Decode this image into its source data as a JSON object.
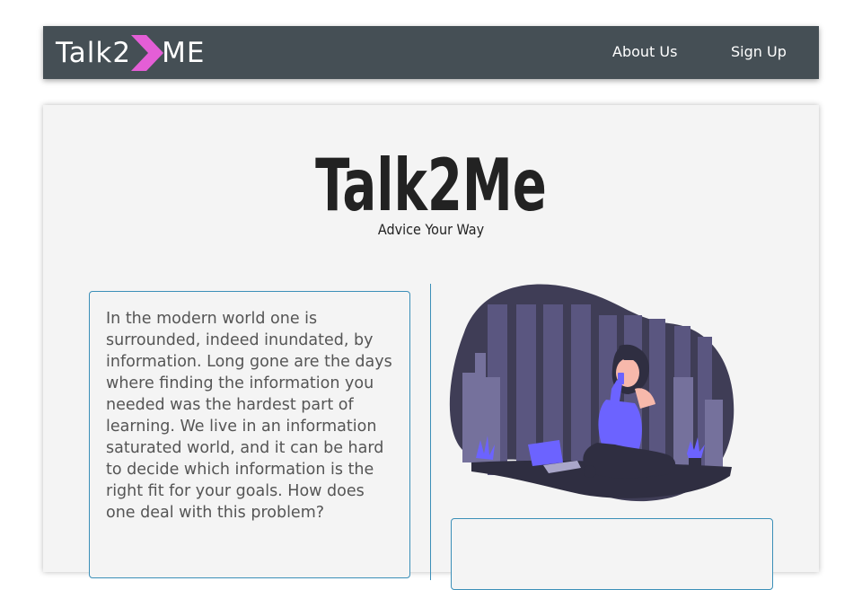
{
  "navbar": {
    "brand": {
      "prefix": "Talk2",
      "suffix": "ME",
      "chevron_color": "#e45ed6"
    },
    "links": [
      {
        "label": "About Us"
      },
      {
        "label": "Sign Up"
      }
    ]
  },
  "hero": {
    "title": "Talk2Me",
    "subtitle": "Advice Your Way"
  },
  "intro": {
    "text": "In the modern world one is surrounded, indeed inundated, by information. Long gone are the days where finding the information you needed was the hardest part of learning. We live in an information saturated world, and it can be hard to decide which information is the right fit for your goals. How does one deal with this problem?"
  },
  "illustration": {
    "icon": "woman-on-phone-city-night-illustration"
  },
  "colors": {
    "navbar": "#454f55",
    "accent": "#3b8fb8",
    "blob": "#3f3d56",
    "purple": "#6c63ff"
  }
}
